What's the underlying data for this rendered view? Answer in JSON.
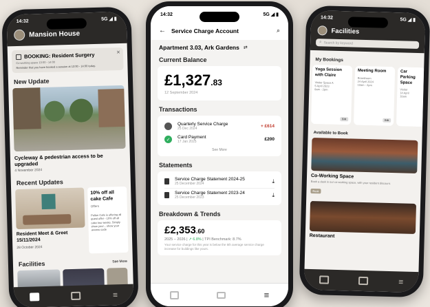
{
  "left": {
    "time": "14:32",
    "signal": "5G ◢ ▮",
    "title": "Mansion House",
    "booking": {
      "title": "BOOKING: Resident Surgery",
      "meta": "Co-working space  13:00 - 14:00",
      "note": "Reminder that you have booked a session at 13:00 - 14:00 today."
    },
    "new_update_heading": "New Update",
    "hero": {
      "title": "Cycleway & pedestrian access to be upgraded",
      "date": "4 November 2024"
    },
    "recent_heading": "Recent Updates",
    "recent": [
      {
        "title": "Resident Meet & Greet 15/11/2024",
        "date": "28 October 2024"
      },
      {
        "title": "10% off all cake Cafe",
        "tag": "Offers",
        "body": "Pollen Cafe is offering all guest offer - 10% off all cake two weeks. Simply show your... show your access code"
      }
    ],
    "facilities_heading": "Facilities",
    "see_more": "See More"
  },
  "center": {
    "time": "14:32",
    "signal": "5G ◢ ▮",
    "header_title": "Service Charge Account",
    "apartment": "Apartment 3.03, Ark Gardens",
    "balance_heading": "Current Balance",
    "balance_main": "£1,327",
    "balance_cents": ".83",
    "balance_date": "12 September 2024",
    "transactions_heading": "Transactions",
    "transactions": [
      {
        "name": "Quarterly Service Charge",
        "date": "25 Dec 2024",
        "amount": "+ £614"
      },
      {
        "name": "Card Payment",
        "date": "17 Jan 2025",
        "amount": "£200"
      }
    ],
    "see_more": "See More",
    "statements_heading": "Statements",
    "statements": [
      {
        "name": "Service Charge Statement 2024-25",
        "date": "25 December 2024"
      },
      {
        "name": "Service Charge Statement 2023-24",
        "date": "25 December 2023"
      }
    ],
    "breakdown_heading": "Breakdown & Trends",
    "breakdown_main": "£2,353",
    "breakdown_cents": ".60",
    "breakdown_period": "2025 – 2026",
    "breakdown_change": "↗ 6.8%",
    "breakdown_benchmark": "TPI Benchmark: 8.7%",
    "breakdown_note": "Your service charge for this year is below the 5th average service charge increase for buildings like yours."
  },
  "right": {
    "time": "14:32",
    "signal": "5G ◢ ▮",
    "title": "Facilities",
    "search_placeholder": "Search by keyword",
    "bookings_heading": "My Bookings",
    "bookings": [
      {
        "title": "Yoga Session with Claire",
        "l1": "Visitor Space A",
        "l2": "5 April 2023",
        "l3": "8am - 2pm",
        "action": "Edit"
      },
      {
        "title": "Meeting Room",
        "l1": "Boardroom",
        "l2": "24 April 2024",
        "l3": "10am - 2pm",
        "action": "Edit"
      },
      {
        "title": "Car Parking Space",
        "l1": "Visitor",
        "l2": "14 April",
        "l3": "10am",
        "action": ""
      }
    ],
    "available_heading": "Available to Book",
    "spaces": [
      {
        "title": "Co-Working Space",
        "desc": "Book a desk in our co-working space, with your resident discount.",
        "action": "Book"
      },
      {
        "title": "Restaurant"
      }
    ]
  },
  "colors": {
    "accent_red": "#c0392b",
    "accent_green": "#2fae5e",
    "dark": "#2b2927"
  }
}
